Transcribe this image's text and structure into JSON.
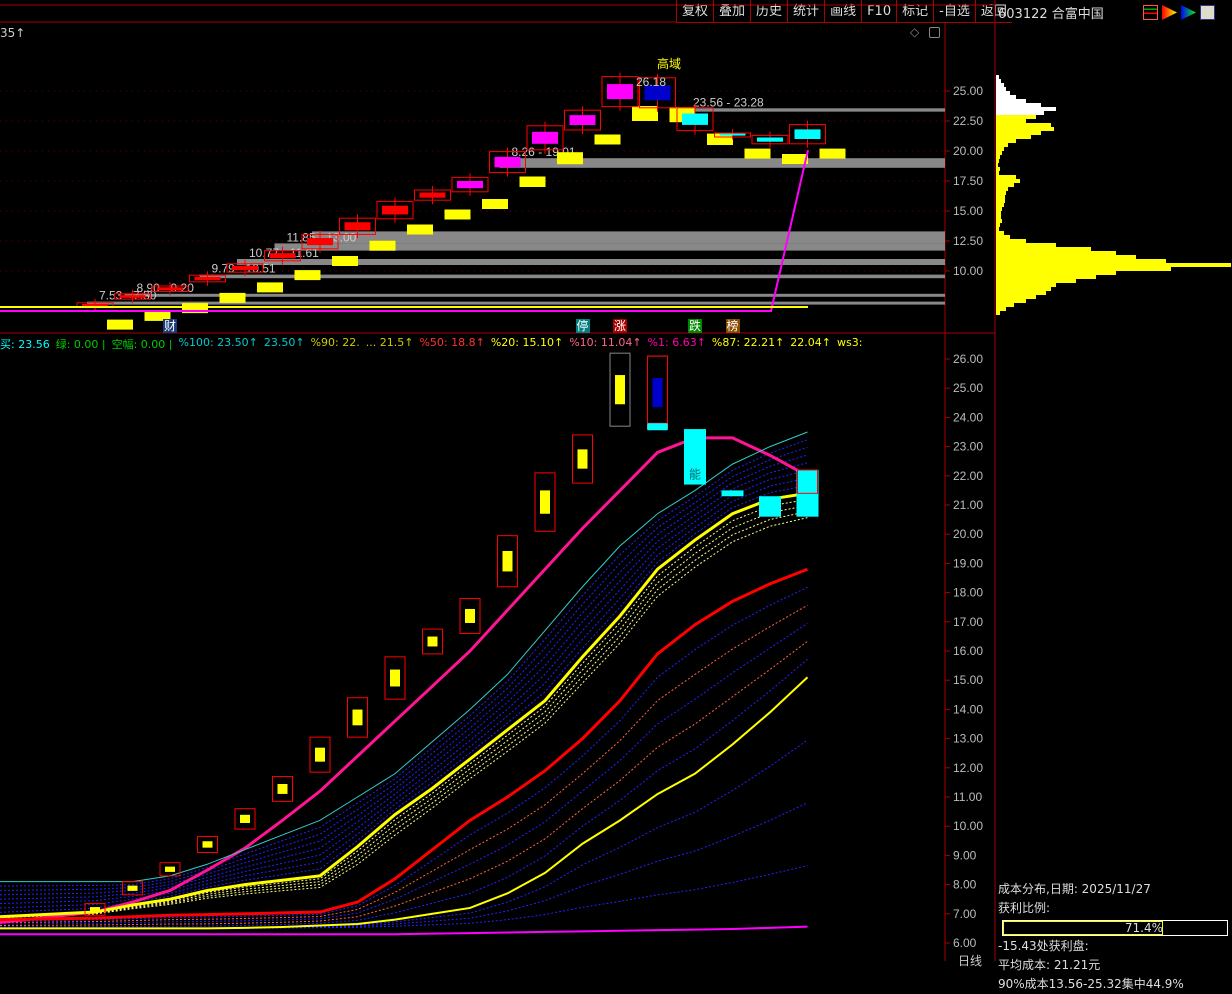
{
  "toolbar": [
    "复权",
    "叠加",
    "历史",
    "统计",
    "画线",
    "F10",
    "标记",
    "-自选",
    "返回"
  ],
  "stock": {
    "code": "603122",
    "name": "合富中国"
  },
  "top_left_label": "35↑",
  "top_panel": {
    "high_label": "高域",
    "high_price": "26.18",
    "zones": [
      {
        "label": "23.56 - 23.28",
        "low": 23.28,
        "high": 23.56,
        "from": 16
      },
      {
        "label": "8.26 - 19.01",
        "low": 18.6,
        "high": 19.4,
        "from": 11
      },
      {
        "label": "",
        "low": 12.3,
        "high": 13.3,
        "from": 6
      },
      {
        "label": "11.85 - 13.00",
        "low": 11.7,
        "high": 12.3,
        "from": 5
      },
      {
        "label": "10.77 - 11.61",
        "low": 10.5,
        "high": 11.0,
        "from": 4
      },
      {
        "label": "9.79 - 10.51",
        "low": 9.4,
        "high": 9.7,
        "from": 3
      },
      {
        "label": "8.90 - 9.20",
        "low": 7.85,
        "high": 8.1,
        "from": 1
      },
      {
        "label": "7.53 - 7.80",
        "low": 7.3,
        "high": 7.45,
        "from": 0
      }
    ],
    "axis": [
      "25.00",
      "22.50",
      "20.00",
      "17.50",
      "15.00",
      "12.50",
      "10.00"
    ]
  },
  "markers": [
    {
      "text": "财",
      "color": "#1a3a7a",
      "day": 2
    },
    {
      "text": "停",
      "color": "#008080",
      "day": 13
    },
    {
      "text": "涨",
      "color": "#a00",
      "day": 14
    },
    {
      "text": "跌",
      "color": "#080",
      "day": 16
    },
    {
      "text": "榜",
      "color": "#8a4a00",
      "day": 17
    }
  ],
  "indicator": [
    {
      "t": "买: 23.56",
      "c": "#0ff"
    },
    {
      "t": "绿: 0.00 |",
      "c": "#0c0"
    },
    {
      "t": "空幅: 0.00 |",
      "c": "#0c0"
    },
    {
      "t": "%100: 23.50↑",
      "c": "#0cc"
    },
    {
      "t": "23.50↑",
      "c": "#0cc"
    },
    {
      "t": "%90: 22.",
      "c": "#cc0"
    },
    {
      "t": "... 21.5↑",
      "c": "#cc0"
    },
    {
      "t": "%50: 18.8↑",
      "c": "#f33"
    },
    {
      "t": "%20: 15.10↑",
      "c": "#ff0"
    },
    {
      "t": "%10: 11.04↑",
      "c": "#f68"
    },
    {
      "t": "%1: 6.63↑",
      "c": "#f0a"
    },
    {
      "t": "%87: 22.21↑",
      "c": "#ff0"
    },
    {
      "t": "22.04↑",
      "c": "#ff0"
    },
    {
      "t": "ws3:",
      "c": "#ff0"
    }
  ],
  "bottom_axis": [
    "26.00",
    "25.00",
    "24.00",
    "23.00",
    "22.00",
    "21.00",
    "20.00",
    "19.00",
    "18.00",
    "17.00",
    "16.00",
    "15.00",
    "14.00",
    "13.00",
    "12.00",
    "11.00",
    "10.00",
    "9.00",
    "8.00",
    "7.00",
    "6.00"
  ],
  "period_label": "日线",
  "energy_label": "能",
  "chart_data": {
    "type": "candlestick",
    "candles": [
      {
        "low": 6.95,
        "high": 7.35,
        "fill": "#ff0"
      },
      {
        "low": 7.65,
        "high": 8.1,
        "fill": "#ff0"
      },
      {
        "low": 8.3,
        "high": 8.75,
        "fill": "#ff0"
      },
      {
        "low": 9.1,
        "high": 9.65,
        "fill": "#ff0"
      },
      {
        "low": 9.9,
        "high": 10.6,
        "fill": "#ff0"
      },
      {
        "low": 10.85,
        "high": 11.7,
        "fill": "#ff0"
      },
      {
        "low": 11.85,
        "high": 13.05,
        "fill": "#ff0"
      },
      {
        "low": 13.05,
        "high": 14.4,
        "fill": "#ff0"
      },
      {
        "low": 14.35,
        "high": 15.8,
        "fill": "#ff0"
      },
      {
        "low": 15.9,
        "high": 16.75,
        "fill": "#ff0"
      },
      {
        "low": 16.6,
        "high": 17.8,
        "fill": "#ff0"
      },
      {
        "low": 18.2,
        "high": 19.95,
        "fill": "#ff0"
      },
      {
        "low": 20.1,
        "high": 22.1,
        "fill": "#ff0"
      },
      {
        "low": 21.75,
        "high": 23.4,
        "fill": "#ff0"
      },
      {
        "low": 23.7,
        "high": 26.2,
        "fill": "#ff0"
      },
      {
        "low": 23.6,
        "high": 26.1,
        "fill": "#00c"
      },
      {
        "low": 21.7,
        "high": 23.6,
        "fill": "#0ff"
      },
      {
        "low": 21.3,
        "high": 21.5,
        "fill": "#0ff"
      },
      {
        "low": 20.6,
        "high": 21.3,
        "fill": "#0ff"
      },
      {
        "low": 20.6,
        "high": 22.2,
        "fill": "#0ff"
      }
    ],
    "series": [
      {
        "name": "pink",
        "color": "#ff1493",
        "width": 3,
        "values": [
          6.7,
          7.06,
          7.4,
          7.8,
          8.5,
          9.25,
          10.2,
          11.2,
          12.4,
          13.6,
          14.8,
          16.0,
          17.4,
          18.8,
          20.2,
          21.5,
          22.8,
          23.3,
          23.3,
          22.7,
          22.0
        ]
      },
      {
        "name": "cyan",
        "color": "#3cc",
        "width": 1,
        "values": [
          8.1,
          8.1,
          8.1,
          8.3,
          8.7,
          9.2,
          9.7,
          10.2,
          11.0,
          11.8,
          12.9,
          14.0,
          15.2,
          16.7,
          18.2,
          19.6,
          20.7,
          21.5,
          22.4,
          23.0,
          23.5
        ]
      },
      {
        "name": "yellow",
        "color": "#ff0",
        "width": 3,
        "values": [
          6.9,
          7.06,
          7.3,
          7.5,
          7.8,
          8.0,
          8.15,
          8.3,
          9.3,
          10.4,
          11.3,
          12.3,
          13.3,
          14.3,
          15.8,
          17.2,
          18.8,
          19.8,
          20.7,
          21.2,
          21.4
        ]
      },
      {
        "name": "red",
        "color": "#f00",
        "width": 3,
        "values": [
          6.8,
          6.85,
          6.9,
          6.95,
          6.97,
          7.0,
          7.03,
          7.06,
          7.4,
          8.2,
          9.2,
          10.2,
          11.0,
          11.9,
          13.0,
          14.3,
          15.9,
          16.9,
          17.7,
          18.3,
          18.8
        ]
      },
      {
        "name": "yellow2",
        "color": "#ff0",
        "width": 2,
        "values": [
          6.5,
          6.5,
          6.5,
          6.5,
          6.5,
          6.52,
          6.55,
          6.6,
          6.65,
          6.8,
          7.0,
          7.2,
          7.7,
          8.4,
          9.4,
          10.2,
          11.1,
          11.8,
          12.8,
          13.9,
          15.1
        ]
      },
      {
        "name": "magenta",
        "color": "#f0f",
        "width": 2,
        "values": [
          6.3,
          6.3,
          6.3,
          6.3,
          6.3,
          6.3,
          6.3,
          6.3,
          6.3,
          6.3,
          6.32,
          6.34,
          6.36,
          6.38,
          6.4,
          6.42,
          6.44,
          6.46,
          6.48,
          6.52,
          6.56
        ]
      }
    ],
    "chip_distribution": [
      3,
      5,
      8,
      10,
      14,
      20,
      30,
      45,
      60,
      48,
      40,
      30,
      55,
      58,
      45,
      35,
      20,
      12,
      8,
      6,
      4,
      3,
      2,
      4,
      3,
      20,
      24,
      18,
      12,
      10,
      9,
      9,
      8,
      6,
      5,
      5,
      6,
      4,
      3,
      8,
      14,
      30,
      60,
      95,
      120,
      140,
      170,
      235,
      175,
      120,
      100,
      80,
      60,
      55,
      50,
      40,
      30,
      18,
      10,
      4
    ],
    "ylim": [
      6,
      26
    ]
  },
  "cost_panel": {
    "title": "成本分布,日期: 2025/11/27",
    "ratio_label": "获利比例:",
    "ratio_value": "71.4%",
    "ratio": 0.714,
    "profit_line": "-15.43处获利盘:",
    "avg_cost": "平均成本: 21.21元",
    "range": "90%成本13.56-25.32集中44.9%"
  }
}
